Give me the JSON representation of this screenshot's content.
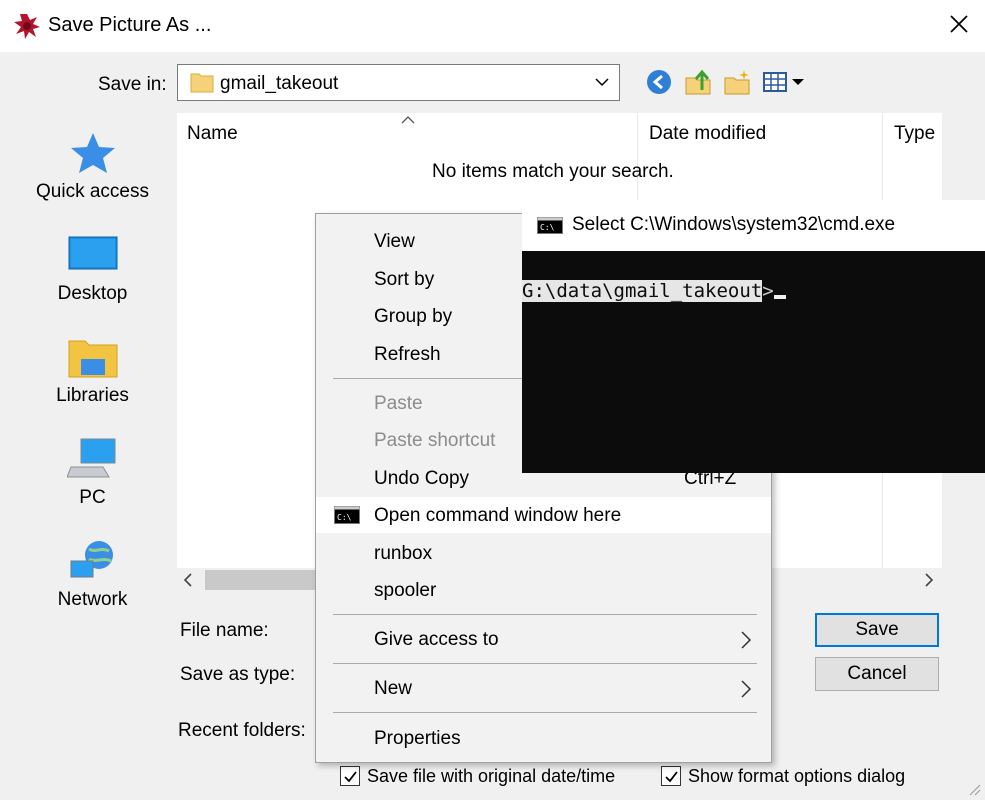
{
  "window": {
    "title": "Save Picture As ...",
    "app_icon": "paint-splat-icon",
    "close_icon": "close-icon"
  },
  "savein": {
    "label": "Save in:",
    "value": "gmail_takeout",
    "folder_icon": "folder-icon"
  },
  "toolbar": {
    "icons": [
      "back-icon",
      "up-folder-icon",
      "new-folder-icon",
      "view-menu-icon"
    ]
  },
  "places": [
    {
      "label": "Quick access",
      "icon": "star-icon"
    },
    {
      "label": "Desktop",
      "icon": "desktop-icon"
    },
    {
      "label": "Libraries",
      "icon": "libraries-icon"
    },
    {
      "label": "PC",
      "icon": "pc-icon"
    },
    {
      "label": "Network",
      "icon": "network-icon"
    }
  ],
  "filelist": {
    "columns": [
      "Name",
      "Date modified",
      "Type"
    ],
    "empty_message": "No items match your search."
  },
  "fields": {
    "file_name_label": "File name:",
    "save_as_type_label": "Save as type:",
    "recent_folders_label": "Recent folders:"
  },
  "buttons": {
    "save": "Save",
    "cancel": "Cancel"
  },
  "checkboxes": {
    "original_date": "Save file with original date/time",
    "format_options": "Show format options dialog"
  },
  "context_menu": {
    "view": "View",
    "sort_by": "Sort by",
    "group_by": "Group by",
    "refresh": "Refresh",
    "paste": "Paste",
    "paste_shortcut": "Paste shortcut",
    "undo_copy": "Undo Copy",
    "undo_copy_shortcut": "Ctrl+Z",
    "open_cmd": "Open command window here",
    "runbox": "runbox",
    "spooler": "spooler",
    "give_access": "Give access to",
    "new": "New",
    "properties": "Properties"
  },
  "cmd_window": {
    "title": "Select C:\\Windows\\system32\\cmd.exe",
    "prompt_path": "G:\\data\\gmail_takeout",
    "prompt_symbol": ">"
  }
}
